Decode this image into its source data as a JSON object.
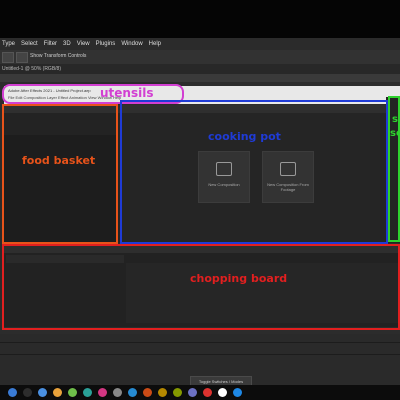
{
  "app": {
    "menu": [
      "Type",
      "Select",
      "Filter",
      "3D",
      "View",
      "Plugins",
      "Window",
      "Help"
    ],
    "options_label": "Show Transform Controls",
    "tab_label": "Untitled-1 @ 50% (RGB/8)",
    "inner_title": "Adobe After Effects 2021 - Untitled Project.aep",
    "inner_menu": "File  Edit  Composition  Layer  Effect  Animation  View  Window  Help",
    "comp_buttons": [
      {
        "label": "New Composition"
      },
      {
        "label": "New Composition From Footage"
      }
    ],
    "toggle_label": "Toggle Switches / Modes"
  },
  "annotations": {
    "utensils": {
      "label": "utensils",
      "color": "#d23fd2"
    },
    "food_basket": {
      "label": "food basket",
      "color": "#e8531a"
    },
    "cooking_pot": {
      "label": "cooking pot",
      "color": "#1f3bd6"
    },
    "side": {
      "label": "s",
      "label2": "se",
      "color": "#2ed12e"
    },
    "chopping_board": {
      "label": "chopping board",
      "color": "#e21f1f"
    }
  },
  "taskbar": {
    "icons": [
      "#3a7bd5",
      "#2d2d2d",
      "#4a90e2",
      "#e9a23b",
      "#6fbf4a",
      "#2aa198",
      "#d33682",
      "#888888",
      "#268bd2",
      "#cb4b16",
      "#b58900",
      "#859900",
      "#6c71c4",
      "#dc322f",
      "#ffffff",
      "#1e88e5"
    ]
  }
}
